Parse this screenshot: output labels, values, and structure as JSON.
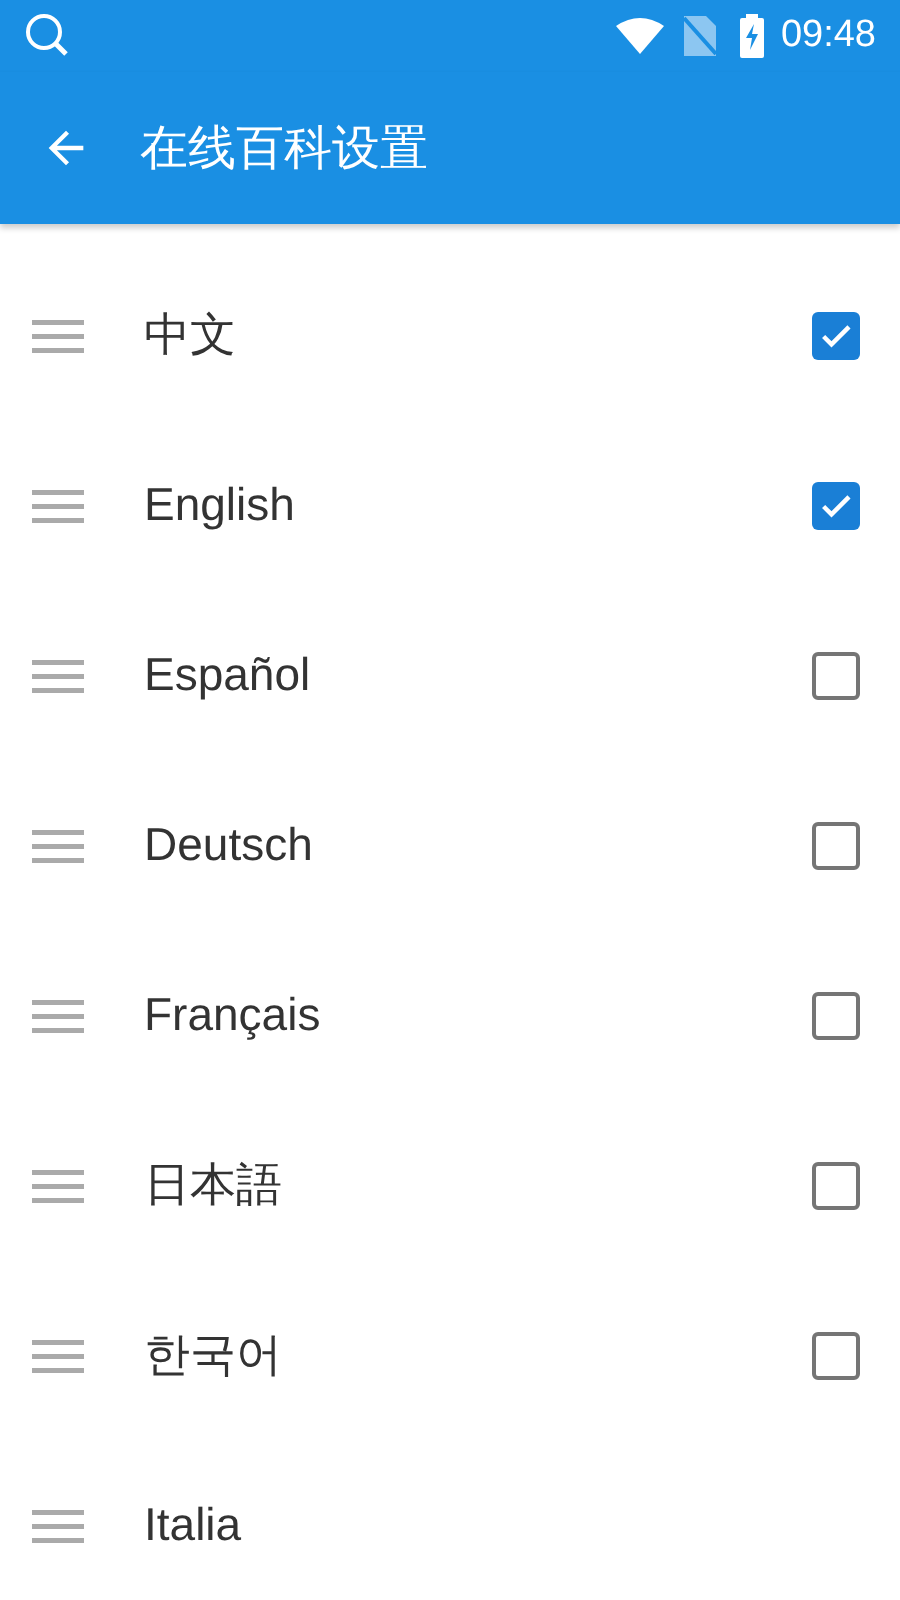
{
  "status_bar": {
    "time": "09:48"
  },
  "app_bar": {
    "title": "在线百科设置"
  },
  "languages": [
    {
      "label": "中文",
      "checked": true
    },
    {
      "label": "English",
      "checked": true
    },
    {
      "label": "Español",
      "checked": false
    },
    {
      "label": "Deutsch",
      "checked": false
    },
    {
      "label": "Français",
      "checked": false
    },
    {
      "label": "日本語",
      "checked": false
    },
    {
      "label": "한국어",
      "checked": false
    },
    {
      "label": "Italia"
    }
  ]
}
